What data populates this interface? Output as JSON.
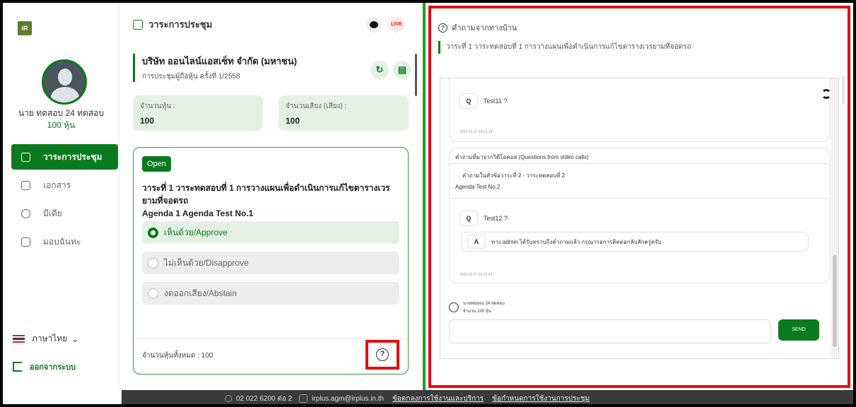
{
  "sidebar": {
    "logo_text": "iR",
    "user_name": "นาย ทดสอบ 24 ทดสอบ",
    "user_shares": "100 หุ้น",
    "nav": [
      {
        "label": "วาระการประชุม",
        "icon": "agenda-icon"
      },
      {
        "label": "เอกสาร",
        "icon": "document-icon"
      },
      {
        "label": "มีเดีย",
        "icon": "media-icon"
      },
      {
        "label": "มอบฉันทะ",
        "icon": "proxy-icon"
      }
    ],
    "language": "ภาษาไทย",
    "logout": "ออกจากระบบ"
  },
  "middle": {
    "header": "วาระการประชุม",
    "live_label": "LIVE",
    "company_name": "บริษัท ออนไลน์แอสเซ็ท จำกัด (มหาชน)",
    "meeting": "การประชุมผู้ถือหุ้น ครั้งที่ 1/2558",
    "shares_label": "จำนวนหุ้น :",
    "shares_value": "100",
    "votes_label": "จำนวนเสียง (เสียง) :",
    "votes_value": "100",
    "status": "Open",
    "agenda_title": "วาระที่ 1 วาระทดสอบที่ 1 การวางแผนเพื่อดำเนินการแก้ไขตารางเวรยามที่จอดรถ",
    "agenda_subtitle": "Agenda 1 Agenda Test No.1",
    "options": [
      "เห็นด้วย/Approve",
      "ไม่เห็นด้วย/Disapprove",
      "งดออกเสียง/Abstain"
    ],
    "selected_option": 0,
    "total_shares": "จำนวนหุ้นทั้งหมด : 100"
  },
  "questions": {
    "header": "คำถามจากทางบ้าน",
    "agenda": "วาระที่ 1 วาระทดสอบที่ 1 การวางแผนเพื่อดำเนินการแก้ไขตารางเวรยามที่จอดรถ",
    "q1": {
      "letter": "Q",
      "text": "Test11 ?",
      "time": "2025-02-17 14:21:14"
    },
    "video_title": "คำถามที่มาจากวิดีโอคอล (Questions from video calls)",
    "video_agenda": "คำถามในหัวข้อวาระที่ 2 - วาระทดสอบที่ 2",
    "video_agenda_en": "Agenda Test No.2",
    "q2": {
      "letter": "Q",
      "text": "Test12 ?",
      "time": "2025-02-17 14:22:43"
    },
    "answer": {
      "letter": "A",
      "text": "ทาง admin ได้รับทราบถึงคำถามแล้ว กรุณารอการติดต่อกลับสักครู่ครับ"
    },
    "me_name": "นายทดสอบ 24 ทดสอบ",
    "me_shares": "จำนวน 100 หุ้น",
    "send": "SEND"
  },
  "footer": {
    "phone": "02 022 6200 ต่อ 2",
    "email": "irplus.agm@irplus.in.th",
    "link1": "ข้อตกลงการใช้งานและบริการ",
    "link2": "ข้อกำหนดการใช้งานการประชุม"
  },
  "colors": {
    "primary": "#0a7a1f",
    "highlight": "#e01010",
    "divider": "#1f9e2f"
  }
}
